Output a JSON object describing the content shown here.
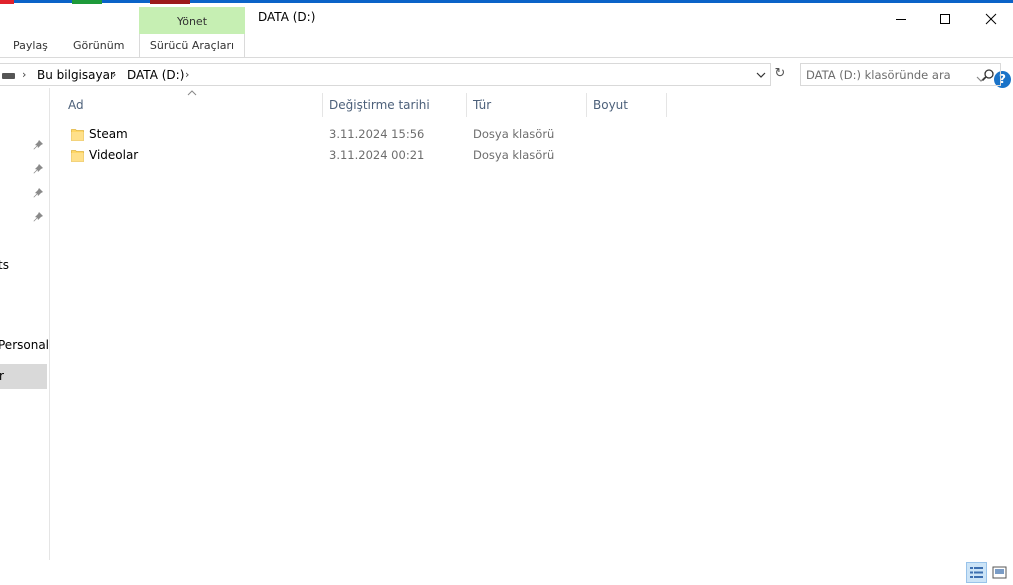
{
  "window": {
    "title": "DATA (D:)",
    "contextual_tab": "Yönet",
    "minimize_icon": "minimize-icon",
    "maximize_icon": "maximize-icon",
    "close_icon": "close-icon"
  },
  "ribbon": {
    "tabs": [
      {
        "label": "Paylaş"
      },
      {
        "label": "Görünüm"
      },
      {
        "label": "Sürücü Araçları"
      }
    ],
    "help": "?"
  },
  "address": {
    "crumbs": [
      "Bu bilgisayar",
      "DATA (D:)"
    ],
    "search_placeholder": "DATA (D:) klasöründe ara"
  },
  "nav": {
    "items": [
      {
        "label": "ts"
      },
      {
        "label": "Personal"
      },
      {
        "label": "r"
      }
    ],
    "selected_index": 2
  },
  "columns": [
    "Ad",
    "Değiştirme tarihi",
    "Tür",
    "Boyut"
  ],
  "files": [
    {
      "name": "Steam",
      "date": "3.11.2024 15:56",
      "type": "Dosya klasörü",
      "size": ""
    },
    {
      "name": "Videolar",
      "date": "3.11.2024 00:21",
      "type": "Dosya klasörü",
      "size": ""
    }
  ],
  "colors": {
    "accent": "#0a63c8",
    "manage_tab": "#c6efb3",
    "folder": "#ffd766",
    "header_text": "#4c607a"
  }
}
